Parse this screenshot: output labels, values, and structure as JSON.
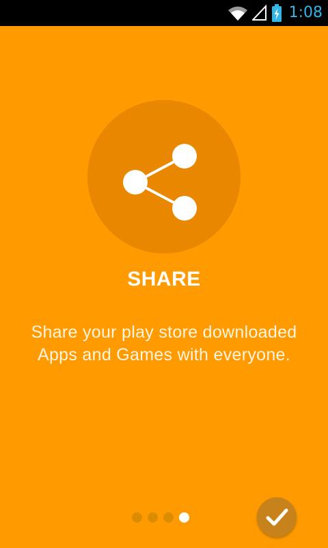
{
  "status_bar": {
    "time": "1:08",
    "icons": [
      "wifi-icon",
      "signal-icon",
      "battery-charging-icon"
    ]
  },
  "onboarding": {
    "icon": "share-icon",
    "title": "SHARE",
    "description": "Share your play store downloaded Apps and Games with everyone."
  },
  "pager": {
    "total_pages": 4,
    "current_page": 4
  },
  "done_button": {
    "icon": "checkmark-icon"
  },
  "colors": {
    "background": "#ff9b00",
    "icon_circle": "#e98800",
    "status_bar": "#000000",
    "time_text": "#33b5e5",
    "dot_active": "#ffffff",
    "dot_inactive": "#d58900",
    "done_button": "#c8821c"
  }
}
